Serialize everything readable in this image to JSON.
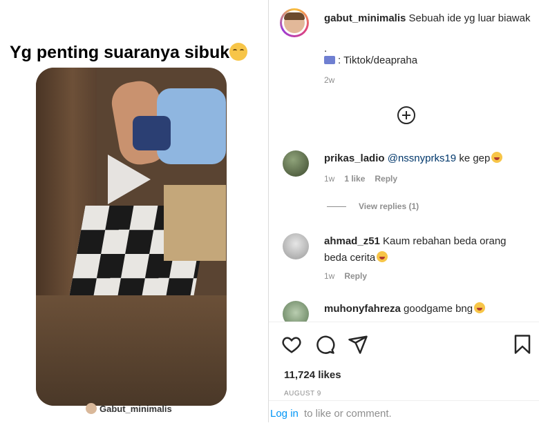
{
  "video_panel": {
    "caption": "Yg penting suaranya sibuk",
    "caption_emoji": "relieved-face",
    "watermark": "Gabut_minimalis"
  },
  "post": {
    "username": "gabut_minimalis",
    "caption": "Sebuah ide yg luar biawak",
    "dot": ".",
    "source": ": Tiktok/deapraha",
    "time": "2w"
  },
  "comments": [
    {
      "username": "prikas_ladio",
      "mention": "@nssnyprks19",
      "text": "ke gep",
      "time": "1w",
      "likes": "1 like",
      "reply": "Reply",
      "view_replies": "View replies (1)"
    },
    {
      "username": "ahmad_z51",
      "text": "Kaum rebahan beda orang beda cerita",
      "time": "1w",
      "reply": "Reply"
    },
    {
      "username": "muhonyfahreza",
      "text": "goodgame bng"
    }
  ],
  "actions": {
    "like_icon": "heart-icon",
    "comment_icon": "comment-icon",
    "share_icon": "send-icon",
    "save_icon": "bookmark-icon"
  },
  "likes": "11,724 likes",
  "date": "AUGUST 9",
  "login": {
    "link": "Log in",
    "text": "to like or comment."
  }
}
